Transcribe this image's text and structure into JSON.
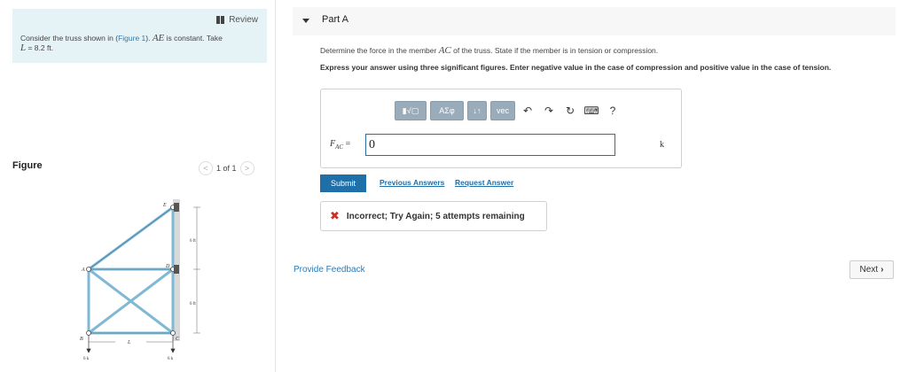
{
  "left": {
    "review_label": "Review",
    "problem": {
      "intro": "Consider the truss shown in (",
      "figure_link": "Figure 1",
      "after_link": "). ",
      "ae": "AE",
      "constant": " is constant. Take",
      "l_symbol": "L",
      "l_value": " = 8.2 ",
      "l_unit": "ft",
      "end": "."
    },
    "figure_label": "Figure",
    "pager": {
      "prev": "<",
      "text": "1 of 1",
      "next": ">"
    },
    "truss": {
      "node_labels": [
        "A",
        "B",
        "C",
        "D",
        "E"
      ],
      "dim_labels": [
        "6 ft",
        "6 ft"
      ],
      "length_label": "L",
      "loads": [
        "6 k",
        "6 k"
      ]
    }
  },
  "right": {
    "part_title": "Part A",
    "question": {
      "pre": "Determine the force in the member ",
      "member": "AC",
      "post": " of the truss. State if the member is in tension or compression."
    },
    "instructions": "Express your answer using three significant figures. Enter negative value in the case of compression and positive value in the case of tension.",
    "toolbar": {
      "templates": "▮√▢",
      "greek": "ΑΣφ",
      "arrows": "↓↑",
      "vec": "vec",
      "undo": "↶",
      "redo": "↷",
      "reset": "↻",
      "keyboard": "⌨",
      "help": "?"
    },
    "answer": {
      "label_f": "F",
      "label_sub": "AC",
      "label_eq": " = ",
      "value": "0",
      "unit": "k"
    },
    "submit_label": "Submit",
    "previous_answers": "Previous Answers",
    "request_answer": "Request Answer",
    "feedback": "Incorrect; Try Again; 5 attempts remaining",
    "provide_feedback": "Provide Feedback",
    "next_label": "Next"
  },
  "colors": {
    "accent": "#1f6fa8",
    "problem_bg": "#e6f3f6",
    "error": "#c9302c",
    "truss_member": "#7fb8d4"
  }
}
